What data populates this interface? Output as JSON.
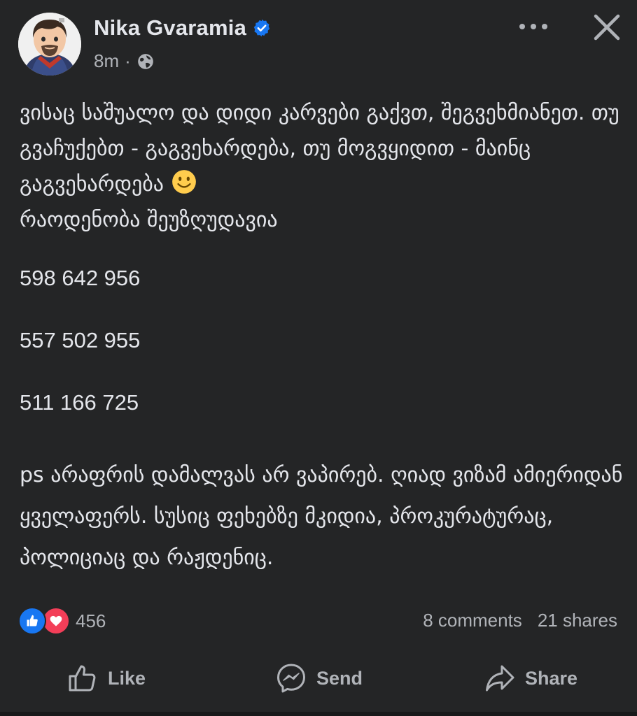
{
  "post": {
    "author": "Nika Gvaramia",
    "verified": true,
    "time": "8m",
    "separator": "·",
    "audience_icon": "globe-icon",
    "body_paragraph": "ვისაც საშუალო და დიდი კარვები გაქვთ, შეგვეხმიანეთ. თუ გვაჩუქებთ - გაგვეხარდება, თუ მოგვყიდით - მაინც გაგვეხარდება",
    "body_paragraph_end": "რაოდენობა შეუზღუდავია",
    "emoji": "slightly-smiling-face",
    "phones": [
      "598 642 956",
      "557 502 955",
      "511 166 725"
    ],
    "ps_text": "ps არაფრის დამალვას არ ვაპირებ. ღიად ვიზამ ამიერიდან ყველაფერს. სუსიც ფეხებზე მკიდია, პროკურატურაც, პოლიციაც და რაჟდენიც."
  },
  "stats": {
    "reaction_count": "456",
    "comments": "8 comments",
    "shares": "21 shares"
  },
  "actions": {
    "like": "Like",
    "send": "Send",
    "share": "Share"
  },
  "colors": {
    "background": "#242526",
    "text": "#e4e6eb",
    "secondary": "#b0b3b8",
    "like_blue": "#1877f2",
    "love_red": "#f33e58",
    "verified_blue": "#1877f2"
  }
}
